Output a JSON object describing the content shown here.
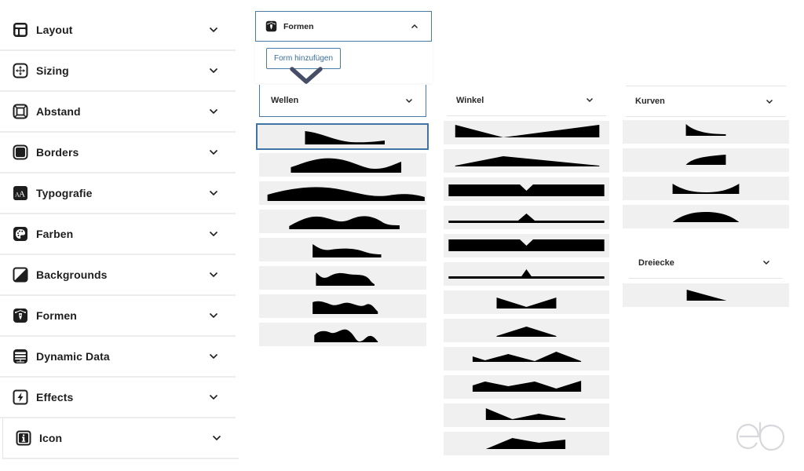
{
  "sidebar": {
    "items": [
      {
        "label": "Layout",
        "icon": "layout-icon"
      },
      {
        "label": "Sizing",
        "icon": "sizing-icon"
      },
      {
        "label": "Abstand",
        "icon": "spacing-icon"
      },
      {
        "label": "Borders",
        "icon": "borders-icon"
      },
      {
        "label": "Typografie",
        "icon": "typography-icon"
      },
      {
        "label": "Farben",
        "icon": "palette-icon"
      },
      {
        "label": "Backgrounds",
        "icon": "backgrounds-icon"
      },
      {
        "label": "Formen",
        "icon": "shapes-icon"
      },
      {
        "label": "Dynamic Data",
        "icon": "database-icon"
      },
      {
        "label": "Effects",
        "icon": "lightning-icon"
      },
      {
        "label": "Icon",
        "icon": "info-icon"
      }
    ]
  },
  "formen_panel": {
    "title": "Formen",
    "expanded": true,
    "add_button_label": "Form hinzufügen"
  },
  "categories": {
    "wellen": {
      "label": "Wellen",
      "shape_count": 8,
      "selected_index": 0
    },
    "winkel": {
      "label": "Winkel",
      "shape_count": 12
    },
    "kurven": {
      "label": "Kurven",
      "shape_count": 4
    },
    "dreiecke": {
      "label": "Dreiecke",
      "shape_count": 1
    }
  },
  "watermark": {
    "text": "eb"
  },
  "colors": {
    "accent": "#4a7ba6",
    "tile_bg": "#f0f0f0",
    "shape_fill": "#000000",
    "text": "#1e1e1e"
  }
}
